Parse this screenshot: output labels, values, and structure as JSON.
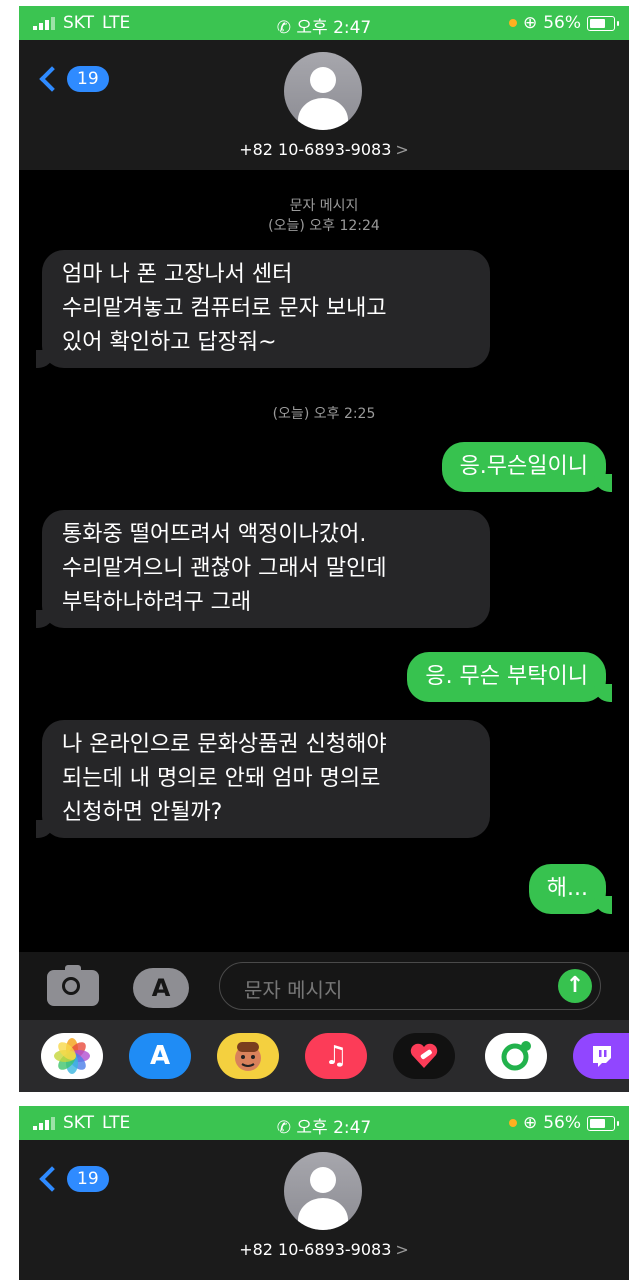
{
  "status": {
    "carrier": "SKT",
    "network": "LTE",
    "time": "오후 2:47",
    "battery": "56%",
    "colors": {
      "bar": "#3bc451"
    },
    "icons": [
      "signal-bars-icon",
      "phone-call-icon",
      "lock-rotation-icon",
      "battery-icon"
    ]
  },
  "header": {
    "back_count": "19",
    "contact": "+82 10-6893-9083",
    "contact_arrow": ">"
  },
  "thread": {
    "service_label": "문자 메시지",
    "stamp1": "(오늘) 오후 12:24",
    "stamp2": "(오늘) 오후 2:25",
    "messages": [
      {
        "dir": "in",
        "lines": [
          "엄마 나 폰 고장나서 센터",
          "수리맡겨놓고 컴퓨터로 문자 보내고",
          "있어 확인하고 답장줘~"
        ]
      },
      {
        "dir": "out",
        "lines": [
          "응.무슨일이니"
        ]
      },
      {
        "dir": "in",
        "lines": [
          "통화중 떨어뜨려서 액정이나갔어.",
          "수리맡겨으니 괜찮아 그래서 말인데",
          "부탁하나하려구 그래"
        ]
      },
      {
        "dir": "out",
        "lines": [
          "응. 무슨 부탁이니"
        ]
      },
      {
        "dir": "in",
        "lines": [
          "나 온라인으로 문화상품권 신청해야",
          "되는데 내 명의로 안돼 엄마 명의로",
          "신청하면 안될까?"
        ]
      },
      {
        "dir": "out",
        "lines": [
          "해..."
        ]
      }
    ],
    "colors": {
      "incoming": "#262628",
      "outgoing": "#37c24f"
    }
  },
  "composer": {
    "placeholder": "문자 메시지",
    "send_symbol": "↑"
  },
  "app_drawer": {
    "apps": [
      "photos-icon",
      "app-store-icon",
      "memoji-icon",
      "music-icon",
      "digital-touch-icon",
      "green-app-icon",
      "twitch-icon"
    ]
  }
}
